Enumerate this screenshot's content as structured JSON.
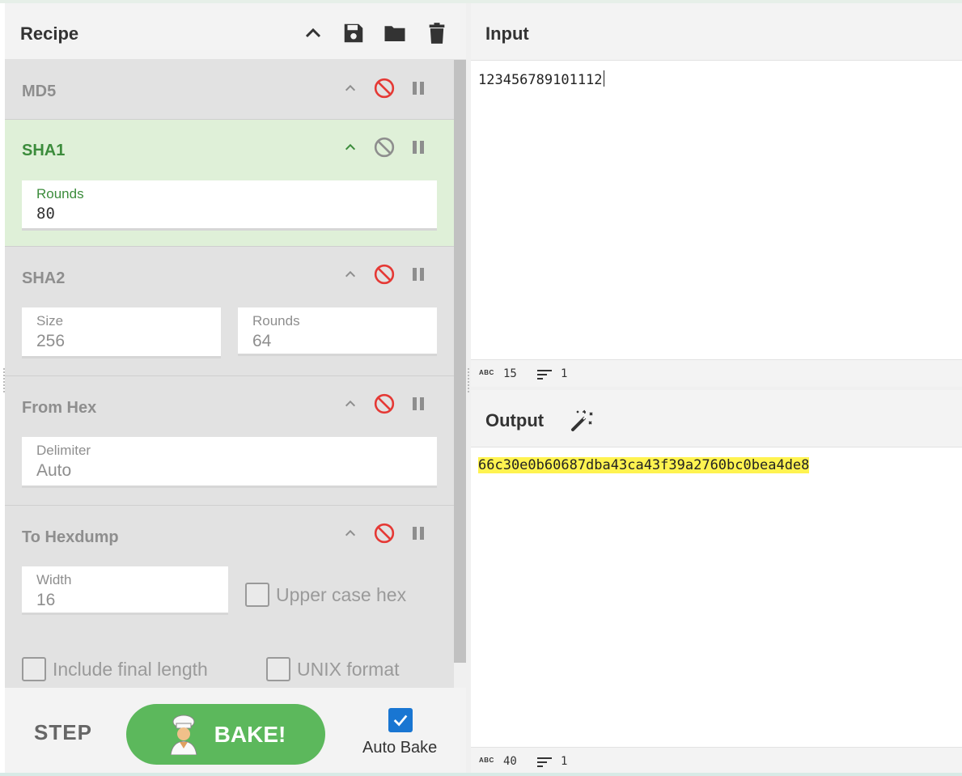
{
  "recipe": {
    "title": "Recipe",
    "icons": [
      "chevron-up-icon",
      "save-icon",
      "folder-icon",
      "trash-icon"
    ],
    "operations": [
      {
        "name": "MD5",
        "state": "disabled"
      },
      {
        "name": "SHA1",
        "state": "active",
        "args": [
          {
            "label": "Rounds",
            "value": "80"
          }
        ]
      },
      {
        "name": "SHA2",
        "state": "disabled",
        "args": [
          {
            "label": "Size",
            "value": "256"
          },
          {
            "label": "Rounds",
            "value": "64"
          }
        ]
      },
      {
        "name": "From Hex",
        "state": "disabled",
        "args": [
          {
            "label": "Delimiter",
            "value": "Auto"
          }
        ]
      },
      {
        "name": "To Hexdump",
        "state": "disabled",
        "args": [
          {
            "label": "Width",
            "value": "16"
          }
        ],
        "checkboxes": [
          {
            "label": "Upper case hex",
            "checked": false
          },
          {
            "label": "Include final length",
            "checked": false
          },
          {
            "label": "UNIX format",
            "checked": false
          }
        ]
      }
    ],
    "footer": {
      "step_label": "STEP",
      "bake_label": "BAKE!",
      "auto_bake_label": "Auto Bake",
      "auto_bake_checked": true
    }
  },
  "input": {
    "title": "Input",
    "text": "123456789101112",
    "status": {
      "length": "15",
      "lines": "1"
    }
  },
  "output": {
    "title": "Output",
    "text": "66c30e0b60687dba43ca43f39a2760bc0bea4de8",
    "status": {
      "length": "40",
      "lines": "1"
    }
  },
  "colors": {
    "active_op": "#dff0d8",
    "active_text": "#3c8c3c",
    "bake_button": "#5cb85c",
    "disable_icon": "#e53935",
    "highlight": "#fff350",
    "checkbox": "#1976d2"
  }
}
